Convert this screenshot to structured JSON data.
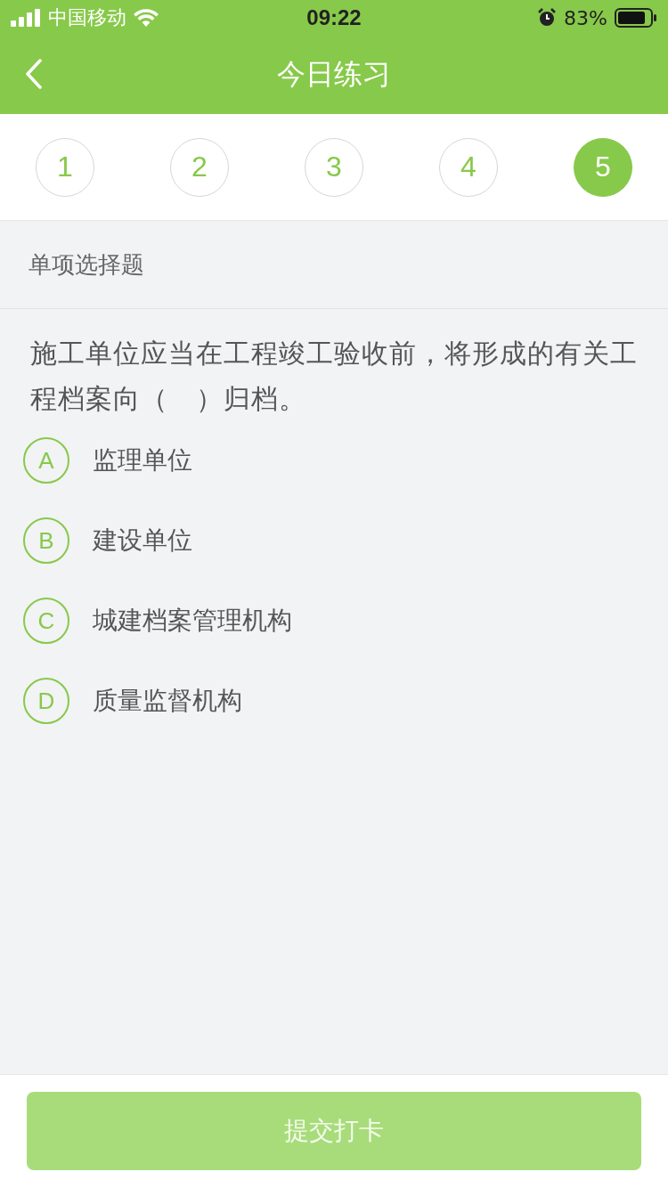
{
  "status_bar": {
    "carrier": "中国移动",
    "time": "09:22",
    "battery": "83%"
  },
  "nav": {
    "title": "今日练习"
  },
  "question_tabs": [
    {
      "label": "1",
      "selected": false
    },
    {
      "label": "2",
      "selected": false
    },
    {
      "label": "3",
      "selected": false
    },
    {
      "label": "4",
      "selected": false
    },
    {
      "label": "5",
      "selected": true
    }
  ],
  "section_label": "单项选择题",
  "question": "施工单位应当在工程竣工验收前，将形成的有关工程档案向（　）归档。",
  "options": [
    {
      "letter": "A",
      "text": "监理单位",
      "selected": false
    },
    {
      "letter": "B",
      "text": "建设单位",
      "selected": false
    },
    {
      "letter": "C",
      "text": "城建档案管理机构",
      "selected": false
    },
    {
      "letter": "D",
      "text": "质量监督机构",
      "selected": false
    }
  ],
  "submit": {
    "label": "提交打卡",
    "disabled": true
  }
}
